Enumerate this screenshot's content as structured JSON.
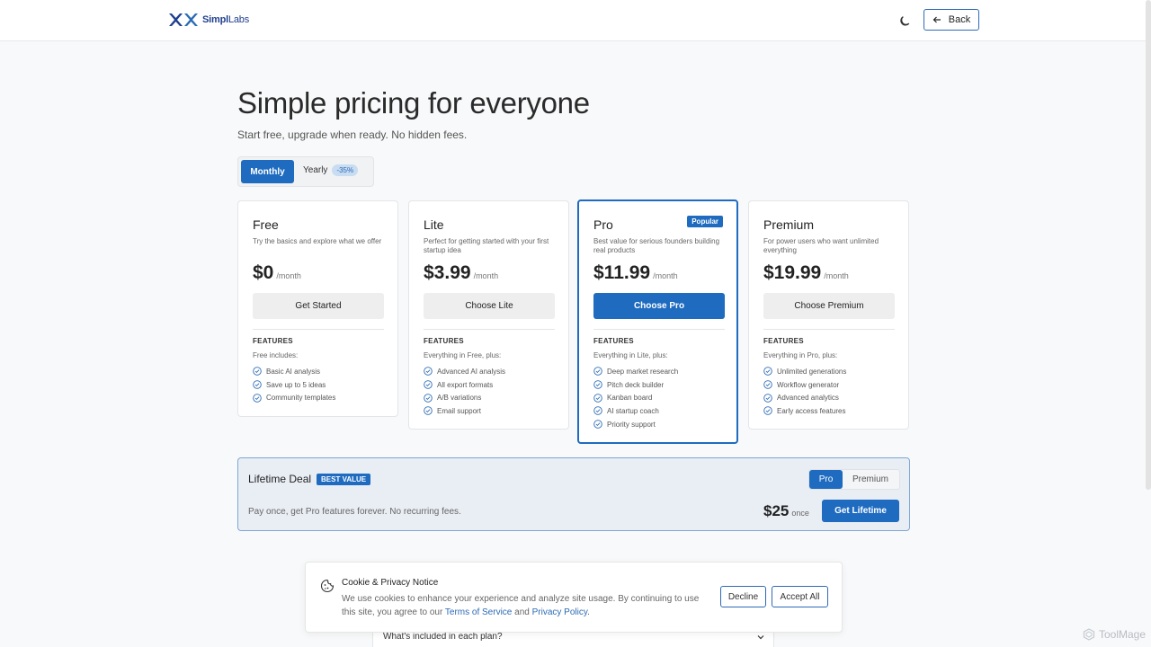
{
  "header": {
    "logo_bold": "Simpl",
    "logo_regular": "Labs",
    "logo_icon": "double-x-logo-icon",
    "theme_icon": "moon-icon",
    "back_label": "Back",
    "back_icon": "arrow-left-icon"
  },
  "hero": {
    "title": "Simple pricing for everyone",
    "subtitle": "Start free, upgrade when ready. No hidden fees."
  },
  "billing": {
    "monthly_label": "Monthly",
    "yearly_label": "Yearly",
    "yearly_discount": "-35%",
    "selected": "Monthly"
  },
  "plans": [
    {
      "name": "Free",
      "description": "Try the basics and explore what we offer",
      "price": "$0",
      "period": "/month",
      "button": "Get Started",
      "features_label": "FEATURES",
      "features_intro": "Free includes:",
      "features": [
        "Basic AI analysis",
        "Save up to 5 ideas",
        "Community templates"
      ]
    },
    {
      "name": "Lite",
      "description": "Perfect for getting started with your first startup idea",
      "price": "$3.99",
      "period": "/month",
      "button": "Choose Lite",
      "features_label": "FEATURES",
      "features_intro": "Everything in Free, plus:",
      "features": [
        "Advanced AI analysis",
        "All export formats",
        "A/B variations",
        "Email support"
      ]
    },
    {
      "name": "Pro",
      "badge": "Popular",
      "description": "Best value for serious founders building real products",
      "price": "$11.99",
      "period": "/month",
      "button": "Choose Pro",
      "features_label": "FEATURES",
      "features_intro": "Everything in Lite, plus:",
      "features": [
        "Deep market research",
        "Pitch deck builder",
        "Kanban board",
        "AI startup coach",
        "Priority support"
      ]
    },
    {
      "name": "Premium",
      "description": "For power users who want unlimited everything",
      "price": "$19.99",
      "period": "/month",
      "button": "Choose Premium",
      "features_label": "FEATURES",
      "features_intro": "Everything in Pro, plus:",
      "features": [
        "Unlimited generations",
        "Workflow generator",
        "Advanced analytics",
        "Early access features"
      ]
    }
  ],
  "lifetime": {
    "title": "Lifetime Deal",
    "badge": "BEST VALUE",
    "description": "Pay once, get Pro features forever. No recurring fees.",
    "switch_pro": "Pro",
    "switch_premium": "Premium",
    "selected": "Pro",
    "price": "$25",
    "period": "once",
    "button": "Get Lifetime"
  },
  "cookie": {
    "icon": "cookie-icon",
    "title": "Cookie & Privacy Notice",
    "text_before": "We use cookies to enhance your experience and analyze site usage. By continuing to use this site, you agree to our ",
    "terms_link": "Terms of Service",
    "text_middle": " and ",
    "privacy_link": "Privacy Policy",
    "text_after": ".",
    "decline": "Decline",
    "accept": "Accept All"
  },
  "faq": {
    "question": "What's included in each plan?",
    "chevron_icon": "chevron-down-icon"
  },
  "watermark": {
    "text": "ToolMage"
  },
  "colors": {
    "accent": "#1e6bc0",
    "background": "#f8f9fa",
    "lifetime_bg": "#e9eef5"
  }
}
